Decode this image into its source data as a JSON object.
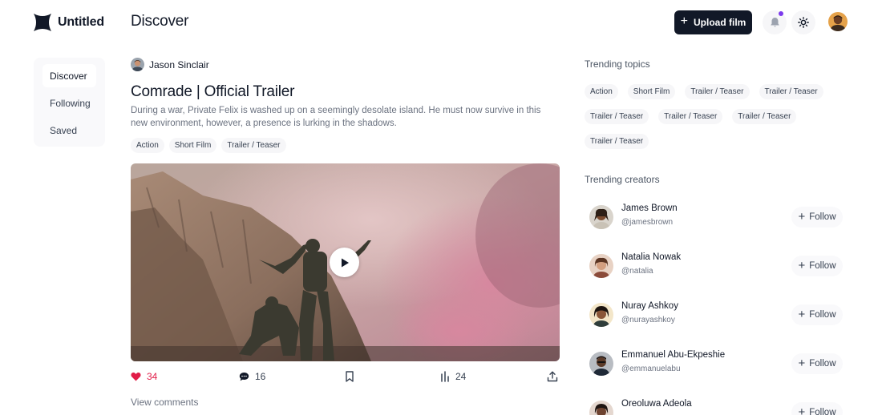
{
  "app": {
    "name": "Untitled"
  },
  "header": {
    "title": "Discover",
    "upload_label": "Upload film",
    "icons": [
      "bell-icon",
      "sun-icon",
      "user-avatar"
    ],
    "accent": "#7c3aed"
  },
  "sidebar": {
    "items": [
      {
        "label": "Discover",
        "active": true
      },
      {
        "label": "Following",
        "active": false
      },
      {
        "label": "Saved",
        "active": false
      }
    ]
  },
  "post": {
    "author": "Jason Sinclair",
    "title": "Comrade | Official Trailer",
    "description": "During a war, Private Felix is washed up on a seemingly desolate island. He must now survive in this new environment, however, a presence is lurking in the shadows.",
    "tags": [
      "Action",
      "Short Film",
      "Trailer / Teaser"
    ],
    "likes": "34",
    "comments": "16",
    "views": "24",
    "view_comments_label": "View comments",
    "like_color": "#e11d48"
  },
  "trending_topics": {
    "title": "Trending topics",
    "items": [
      "Action",
      "Short Film",
      "Trailer / Teaser",
      "Trailer / Teaser",
      "Trailer / Teaser",
      "Trailer / Teaser",
      "Trailer / Teaser",
      "Trailer / Teaser"
    ]
  },
  "trending_creators": {
    "title": "Trending creators",
    "follow_label": "Follow",
    "items": [
      {
        "name": "James Brown",
        "handle": "@jamesbrown"
      },
      {
        "name": "Natalia Nowak",
        "handle": "@natalia"
      },
      {
        "name": "Nuray Ashkoy",
        "handle": "@nurayashkoy"
      },
      {
        "name": "Emmanuel Abu-Ekpeshie",
        "handle": "@emmanuelabu"
      },
      {
        "name": "Oreoluwa Adeola",
        "handle": ""
      }
    ]
  }
}
